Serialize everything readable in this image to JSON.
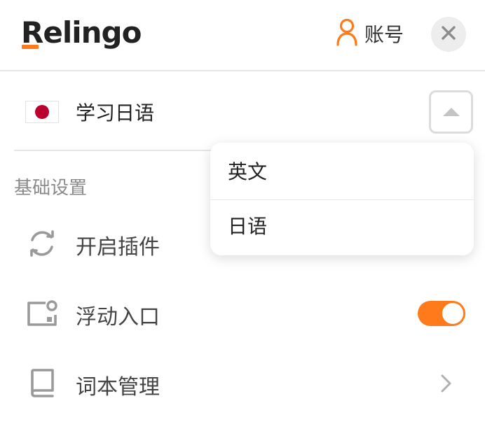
{
  "header": {
    "logo_text": "Relingo",
    "account_label": "账号",
    "icons": {
      "account": "user-icon",
      "close": "close-icon"
    }
  },
  "language": {
    "current_label": "学习日语",
    "flag": "japan-flag-icon",
    "toggle_icon": "caret-up-icon",
    "options": [
      "英文",
      "日语"
    ]
  },
  "settings": {
    "section_title": "基础设置",
    "items": [
      {
        "label": "开启插件",
        "icon": "refresh-icon"
      },
      {
        "label": "浮动入口",
        "icon": "floating-window-icon",
        "toggle_on": true
      },
      {
        "label": "词本管理",
        "icon": "book-icon",
        "trailing": "chevron-right-icon"
      }
    ]
  },
  "colors": {
    "accent": "#ff7a1a",
    "flag_red": "#bc002d",
    "icon_gray": "#9a9a9a",
    "divider": "#e6e6e6"
  }
}
